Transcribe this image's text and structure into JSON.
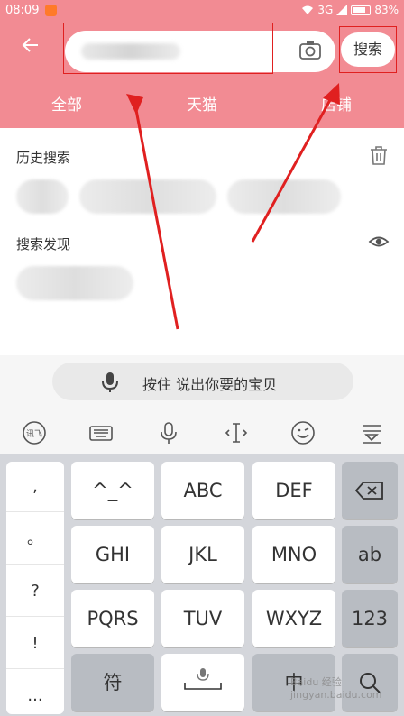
{
  "status": {
    "time": "08:09",
    "network": "3G",
    "battery": "83%"
  },
  "header": {
    "search_button": "搜索"
  },
  "tabs": [
    "全部",
    "天猫",
    "店铺"
  ],
  "history": {
    "title": "历史搜索"
  },
  "discover": {
    "title": "搜索发现"
  },
  "voice": {
    "label": "按住 说出你要的宝贝"
  },
  "punctuation": [
    ",",
    "。",
    "?",
    "!",
    "..."
  ],
  "keys": {
    "row1": [
      "^_^",
      "ABC",
      "DEF"
    ],
    "row2": [
      "GHI",
      "JKL",
      "MNO",
      "ab"
    ],
    "row3": [
      "PQRS",
      "TUV",
      "WXYZ",
      "123"
    ],
    "row4": [
      "符",
      "中"
    ]
  },
  "watermark": "Baidu 经验\njingyan.baidu.com",
  "colors": {
    "accent": "#f28b93",
    "annotation": "#e02020"
  }
}
